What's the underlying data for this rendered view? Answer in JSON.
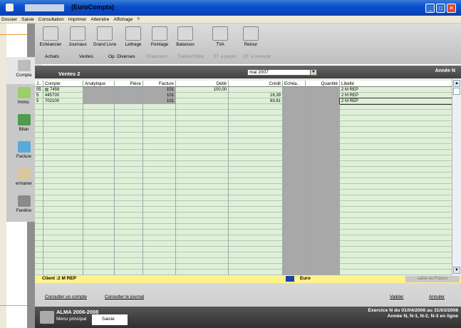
{
  "window": {
    "title": "(EuroCompta)"
  },
  "menu": [
    "Dossier",
    "Saisie",
    "Consultation",
    "Imprimer",
    "Atteindre",
    "Affichage",
    "?"
  ],
  "toolbar": [
    {
      "label": "Echéancier",
      "icon": "calendar-icon"
    },
    {
      "label": "Journaux",
      "icon": "journal-icon"
    },
    {
      "label": "Grand Livre",
      "icon": "ledger-icon"
    },
    {
      "label": "Lettrage",
      "icon": "lettering-icon"
    },
    {
      "label": "Pointage",
      "icon": "pointing-icon"
    },
    {
      "label": "Balances",
      "icon": "balance-icon"
    },
    {
      "label": "TVA",
      "icon": "vat-icon"
    },
    {
      "label": "Retour",
      "icon": "back-icon"
    }
  ],
  "journals": [
    {
      "label": "Achats",
      "enabled": true
    },
    {
      "label": "Ventes",
      "enabled": true
    },
    {
      "label": "Op. Diverses",
      "enabled": true
    },
    {
      "label": "Financiers",
      "enabled": false
    },
    {
      "label": "Trailes/Chèq.",
      "enabled": false
    },
    {
      "label": "Ef. à payer",
      "enabled": false
    },
    {
      "label": "Ef. à recevoir",
      "enabled": false
    }
  ],
  "left_nav": [
    "Compta",
    "Immo.",
    "Bilan",
    "Facture",
    "ermaner",
    "Fenêtre"
  ],
  "journal_title": "Ventes 2",
  "period": "mai 2007",
  "year_label": "Année N",
  "columns": [
    "J..",
    "Compte",
    "Analytique",
    "Pièce",
    "Facture",
    "Débit",
    "Crédit",
    "Echéa..",
    "Quantité",
    "Libellé"
  ],
  "rows": [
    {
      "j": "05",
      "compte": "7459",
      "analytique": "",
      "piece": "",
      "facture": "101",
      "debit": "100,00",
      "credit": "",
      "echeance": "",
      "quantite": "",
      "libelle": "2 M REP"
    },
    {
      "j": "5",
      "compte": "445700",
      "analytique": "",
      "piece": "",
      "facture": "101",
      "debit": "",
      "credit": "16,39",
      "echeance": "",
      "quantite": "",
      "libelle": "2 M REP"
    },
    {
      "j": "5",
      "compte": "702100",
      "analytique": "",
      "piece": "",
      "facture": "101",
      "debit": "",
      "credit": "83,61",
      "echeance": "",
      "quantite": "",
      "libelle": "2 M REP"
    }
  ],
  "client_footer": "Client :2 M REP",
  "currency": "Euro",
  "currency_toggle": "saisir en Francs",
  "actions": {
    "consult_account": "Consulter un compte",
    "consult_journal": "Consulter le journal",
    "validate": "Valider",
    "cancel": "Annuler"
  },
  "status": {
    "app": "ALMA 2006-2008",
    "menu": "Menu principal",
    "tab": "Saisie",
    "exercise_line1": "Exercice N du 01/04/2006 au 31/03/2008",
    "exercise_line2": "Année N, N-1, N-2, N-3 en ligne"
  }
}
